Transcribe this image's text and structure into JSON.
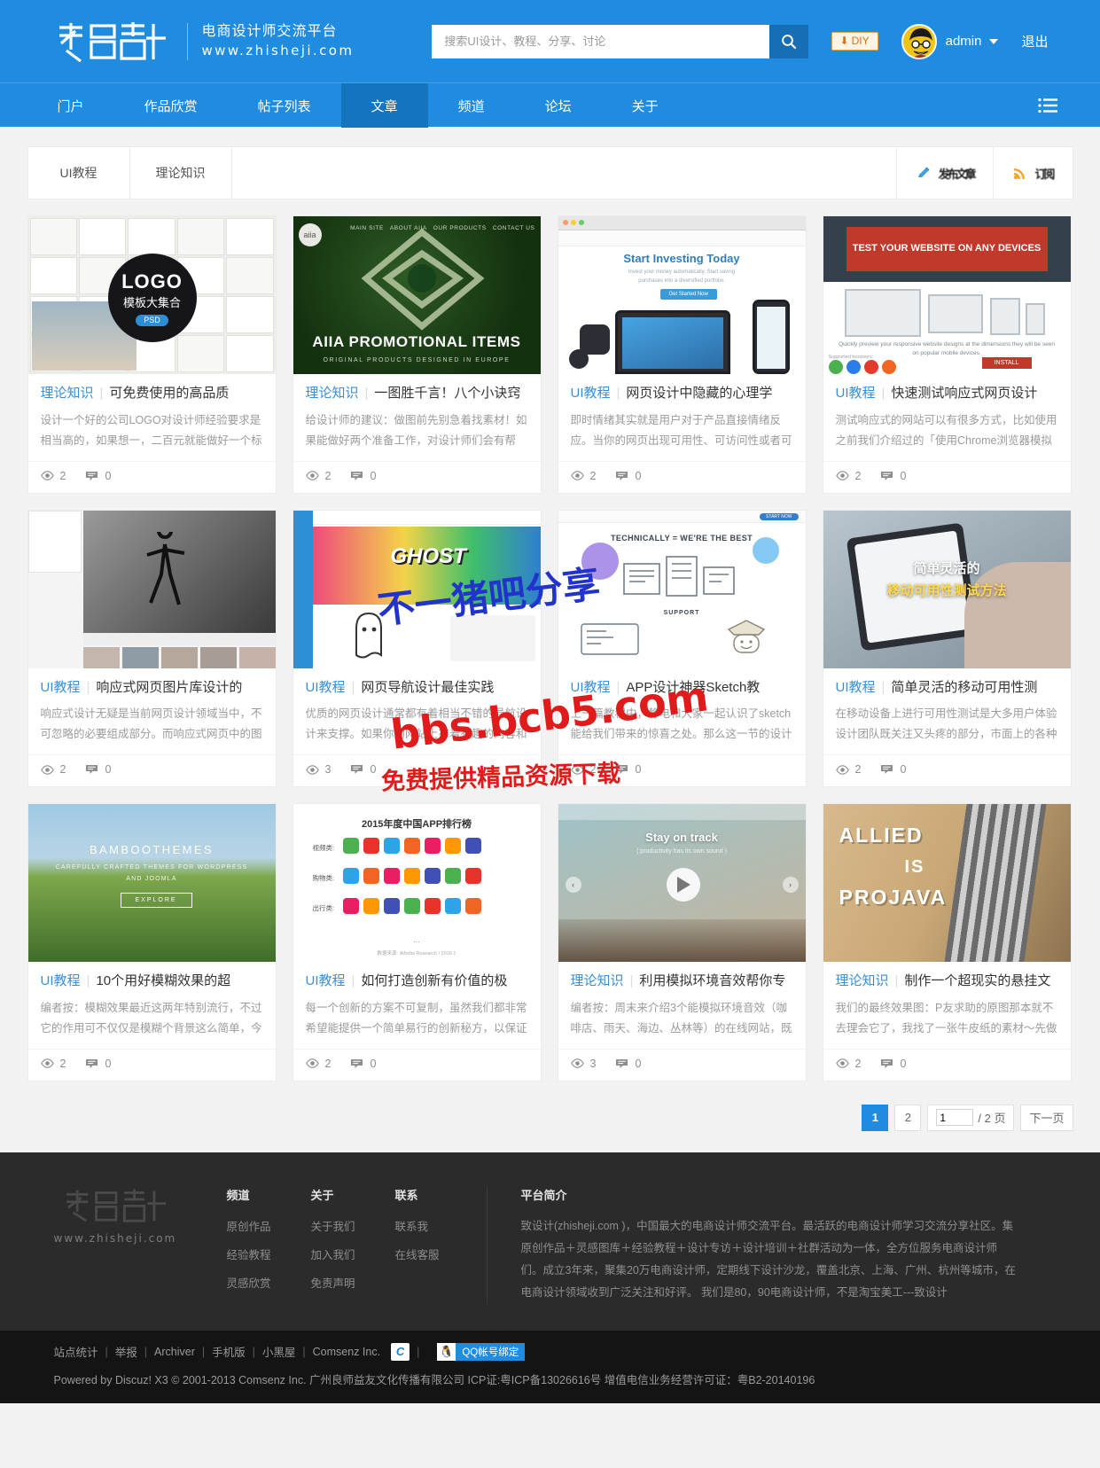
{
  "header": {
    "logo_main": "致设计",
    "logo_sub1": "电商设计师交流平台",
    "logo_sub2": "www.zhisheji.com",
    "search_placeholder": "搜索UI设计、教程、分享、讨论",
    "search_value": "",
    "search_icon": "search-icon",
    "diy_label": "DIY",
    "username": "admin",
    "logout_label": "退出"
  },
  "nav": {
    "items": [
      {
        "label": "门户",
        "active": false
      },
      {
        "label": "作品欣赏",
        "active": false
      },
      {
        "label": "帖子列表",
        "active": false
      },
      {
        "label": "文章",
        "active": true
      },
      {
        "label": "频道",
        "active": false
      },
      {
        "label": "论坛",
        "active": false
      },
      {
        "label": "关于",
        "active": false
      }
    ],
    "menu_icon": "list-menu-icon"
  },
  "tabbar": {
    "tabs": [
      {
        "label": "UI教程"
      },
      {
        "label": "理论知识"
      }
    ],
    "actions": [
      {
        "icon": "pencil-icon",
        "label": "发布文章"
      },
      {
        "icon": "rss-icon",
        "label": "订阅"
      }
    ]
  },
  "cards": [
    {
      "cat": "理论知识",
      "title": "可免费使用的高品质",
      "desc": "设计一个好的公司LOGO对设计师经验要求是相当高的，如果想一，二百元就能做好一个标",
      "views": "2",
      "comments": "0",
      "thumb": "logo-templates-collage"
    },
    {
      "cat": "理论知识",
      "title": "一图胜千言！八个小诀窍",
      "desc": "给设计师的建议：做图前先别急着找素材！如果能做好两个准备工作，对设计师们会有帮",
      "views": "2",
      "comments": "0",
      "thumb": "aiia-promotional-items"
    },
    {
      "cat": "UI教程",
      "title": "网页设计中隐藏的心理学",
      "desc": "即时情绪其实就是用户对于产品直接情绪反应。当你的网页出现可用性、可访问性或者可",
      "views": "2",
      "comments": "0",
      "thumb": "start-investing-today"
    },
    {
      "cat": "UI教程",
      "title": "快速测试响应式网页设计",
      "desc": "测试响应式的网站可以有很多方式，比如使用之前我们介绍过的「使用Chrome浏览器模拟",
      "views": "2",
      "comments": "0",
      "thumb": "test-website-any-device"
    },
    {
      "cat": "UI教程",
      "title": "响应式网页图片库设计的",
      "desc": "响应式设计无疑是当前网页设计领域当中，不可忽略的必要组成部分。而响应式网页中的图",
      "views": "2",
      "comments": "0",
      "thumb": "bw-dancer-photo"
    },
    {
      "cat": "UI教程",
      "title": "网页导航设计最佳实践",
      "desc": "优质的网页设计通常都有着相当不错的导航设计来支撑。如果你的网站上有着有趣的内容和受",
      "views": "3",
      "comments": "0",
      "thumb": "ghost-graffiti-site"
    },
    {
      "cat": "UI教程",
      "title": "APP设计神器Sketch教",
      "desc": "上一篇教程中，静电和大家一起认识了sketch能给我们带来的惊喜之处。那么这一节的设计教",
      "views": "2",
      "comments": "0",
      "thumb": "technically-we-are-the-best"
    },
    {
      "cat": "UI教程",
      "title": "简单灵活的移动可用性测",
      "desc": "在移动设备上进行可用性测试是大多用户体验设计团队既关注又头疼的部分，市面上的各种",
      "views": "2",
      "comments": "0",
      "thumb": "mobile-usability-hand"
    },
    {
      "cat": "UI教程",
      "title": "10个用好模糊效果的超",
      "desc": "编者按：模糊效果最近这两年特别流行，不过它的作用可不仅仅是模糊个背景这么简单，今",
      "views": "2",
      "comments": "0",
      "thumb": "bamboothemes-hero"
    },
    {
      "cat": "UI教程",
      "title": "如何打造创新有价值的极",
      "desc": "每一个创新的方案不可复制，虽然我们都非常希望能提供一个简单易行的创新秘方，以保证",
      "views": "2",
      "comments": "0",
      "thumb": "app-ranking-2015"
    },
    {
      "cat": "理论知识",
      "title": "利用模拟环境音效帮你专",
      "desc": "编者按：周末来介绍3个能模拟环境音效（咖啡店、雨天、海边、丛林等）的在线网站，既可",
      "views": "3",
      "comments": "0",
      "thumb": "stay-on-track-coffee"
    },
    {
      "cat": "理论知识",
      "title": "制作一个超现实的悬挂文",
      "desc": "我们的最终效果图：P友求助的原图那本就不去理会它了，我找了一张牛皮纸的素材～先做",
      "views": "2",
      "comments": "0",
      "thumb": "allied-is-projava"
    }
  ],
  "card_thumbs": {
    "t1_logo_badge": "LOGO",
    "t1_logo_sub": "模板大集合",
    "t1_logo_psd": "PSD",
    "t2_title": "AIIA PROMOTIONAL ITEMS",
    "t2_sub": "ORIGINAL PRODUCTS DESIGNED IN EUROPE",
    "t3_title": "Start Investing Today",
    "t4_title": "TEST YOUR WEBSITE ON ANY DEVICES",
    "t4_sub": "Quickly preview your responsive website designs at the dimensions they will be seen on popular mobile devices.",
    "t4_btn": "INSTALL",
    "t4_supported": "Supported browsers:",
    "t6_word": "GHOST",
    "t7_title": "TECHNICALLY = WE'RE THE BEST",
    "t7_support": "SUPPORT",
    "t8_line1": "简单灵活的",
    "t8_line2": "移动可用性测试方法",
    "t9_title": "BAMBOOTHEMES",
    "t9_sub": "CAREFULLY CRAFTED THEMES FOR WORDPRESS AND JOOMLA",
    "t9_btn": "EXPLORE",
    "t10_title": "2015年度中国APP排行榜",
    "t10_rows": [
      "视频类:",
      "购物类:",
      "出行类:"
    ],
    "t10_note": "数据来源: iiMedia Research / 2016.1",
    "t11_title": "Stay on track",
    "t11_sub": "( productivity has its own sound )",
    "t12_line1": "ALLIED",
    "t12_line2": "IS",
    "t12_line3": "PROJAVA"
  },
  "watermark": {
    "line1": "不一猪吧分享",
    "line2": "bbs.bcb5.com",
    "line3": "免费提供精品资源下载"
  },
  "pagination": {
    "pages": [
      {
        "label": "1",
        "active": true
      },
      {
        "label": "2",
        "active": false
      }
    ],
    "jump_value": "1",
    "jump_suffix": "/ 2 页",
    "next_label": "下一页"
  },
  "footer": {
    "logo_main": "致设计",
    "logo_url": "www.zhisheji.com",
    "columns": [
      {
        "title": "频道",
        "links": [
          "原创作品",
          "经验教程",
          "灵感欣赏"
        ]
      },
      {
        "title": "关于",
        "links": [
          "关于我们",
          "加入我们",
          "免责声明"
        ]
      },
      {
        "title": "联系",
        "links": [
          "联系我",
          "在线客服"
        ]
      }
    ],
    "about_title": "平台简介",
    "about_text": "致设计(zhisheji.com )，中国最大的电商设计师交流平台。最活跃的电商设计师学习交流分享社区。集原创作品＋灵感图库＋经验教程＋设计专访＋设计培训＋社群活动为一体，全方位服务电商设计师们。成立3年来，聚集20万电商设计师，定期线下设计沙龙，覆盖北京、上海、广州、杭州等城市，在电商设计领域收到广泛关注和好评。 我们是80，90电商设计师，不是淘宝美工---致设计",
    "bottom_links": [
      "站点统计",
      "举报",
      "Archiver",
      "手机版",
      "小黑屋",
      "Comsenz Inc."
    ],
    "cnzz_icon": "cnzz-icon",
    "qq_icon": "qq-penguin-icon",
    "qq_label": "QQ帐号绑定",
    "copyright": "Powered by Discuz! X3  © 2001-2013 Comsenz Inc.  广州良师益友文化传播有限公司 ICP证:粤ICP备13026616号  增值电信业务经营许可证：粤B2-20140196"
  }
}
